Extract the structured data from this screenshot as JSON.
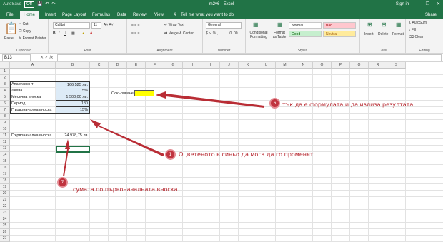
{
  "window": {
    "autosave": "AutoSave",
    "autosave_state": "Off",
    "title": "m2v6  -  Excel",
    "sign_in": "Sign in",
    "share": "Share"
  },
  "tabs": [
    "File",
    "Home",
    "Insert",
    "Page Layout",
    "Formulas",
    "Data",
    "Review",
    "View"
  ],
  "tell_me": "Tell me what you want to do",
  "ribbon": {
    "clipboard": {
      "label": "Clipboard",
      "paste": "Paste",
      "cut": "Cut",
      "copy": "Copy",
      "format_painter": "Format Painter"
    },
    "font": {
      "label": "Font",
      "font_name": "Calibri",
      "font_size": "11"
    },
    "alignment": {
      "label": "Alignment",
      "wrap_text": "Wrap Text",
      "merge_center": "Merge & Center"
    },
    "number": {
      "label": "Number",
      "format": "General"
    },
    "styles": {
      "label": "Styles",
      "conditional": "Conditional Formatting",
      "format_table": "Format as Table",
      "normal": "Normal",
      "bad": "Bad",
      "good": "Good",
      "neutral": "Neutral"
    },
    "cells": {
      "label": "Cells",
      "insert": "Insert",
      "delete": "Delete",
      "format": "Format"
    },
    "editing": {
      "label": "Editing",
      "autosum": "AutoSum",
      "fill": "Fill",
      "clear": "Clear"
    }
  },
  "formula_bar": {
    "name_box": "B13",
    "fx": "fx",
    "content": ""
  },
  "columns": [
    "A",
    "B",
    "C",
    "D",
    "E",
    "F",
    "G",
    "H",
    "I",
    "J",
    "K",
    "L",
    "M",
    "N",
    "O",
    "P",
    "Q",
    "R",
    "S"
  ],
  "rows": [
    "1",
    "2",
    "3",
    "4",
    "5",
    "6",
    "7",
    "8",
    "9",
    "10",
    "11",
    "12",
    "13",
    "14",
    "15",
    "16",
    "17",
    "18",
    "19",
    "20",
    "21",
    "22",
    "23",
    "24",
    "25",
    "26",
    "27",
    "28"
  ],
  "cells": {
    "a3": "Апартамент",
    "b3": "166 525 лв.",
    "a4": "Лихва",
    "b4": "5%",
    "a5": "Месечна вноска",
    "b5": "1 500,00 лв.",
    "a6": "Период",
    "b6": "180",
    "a7": "Първоначална вноска",
    "b7": "15%",
    "d4": "Оскъпяване",
    "a11": "Първоначална вноска",
    "b11": "24 978,75 лв."
  },
  "annotations": {
    "badge6": "6",
    "text6": "тък да е формулата и да излиза резултата",
    "badge1": "1",
    "text1": "Оцветеното в синьо да мога да го променят",
    "badge7": "7",
    "text7": "сумата по първоначалната вноска"
  },
  "colors": {
    "excel_green": "#217346",
    "input_blue": "#ddebf7",
    "highlight_yellow": "#ffff00",
    "annotation_red": "#b5222a"
  }
}
